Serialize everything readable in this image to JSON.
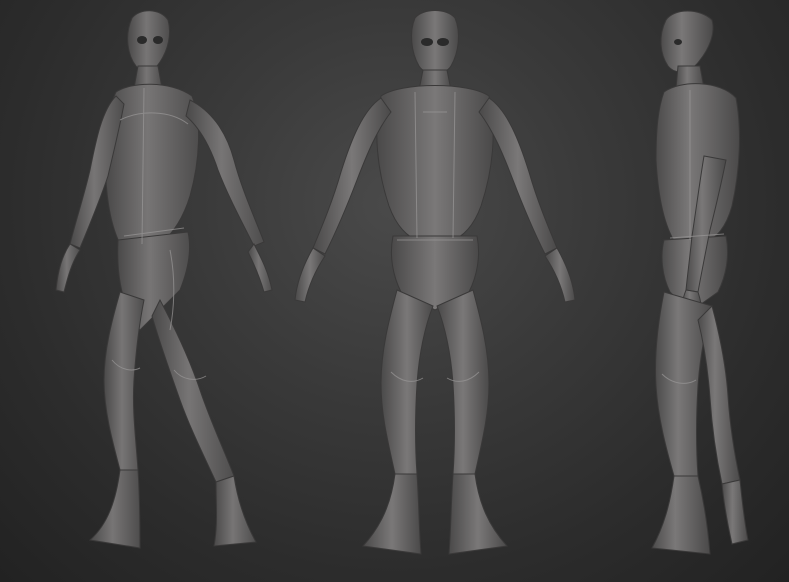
{
  "scene": {
    "background_color": "#2e2e2e",
    "figure_color": "#6b6a6a",
    "figure_highlight": "#8a8888",
    "figure_shadow": "#3e3d3d",
    "seam_color": "#9a9898",
    "views": [
      {
        "name": "three-quarter-view",
        "icon": "alien-figure-icon"
      },
      {
        "name": "front-view",
        "icon": "alien-figure-icon"
      },
      {
        "name": "side-view",
        "icon": "alien-figure-icon"
      }
    ]
  }
}
